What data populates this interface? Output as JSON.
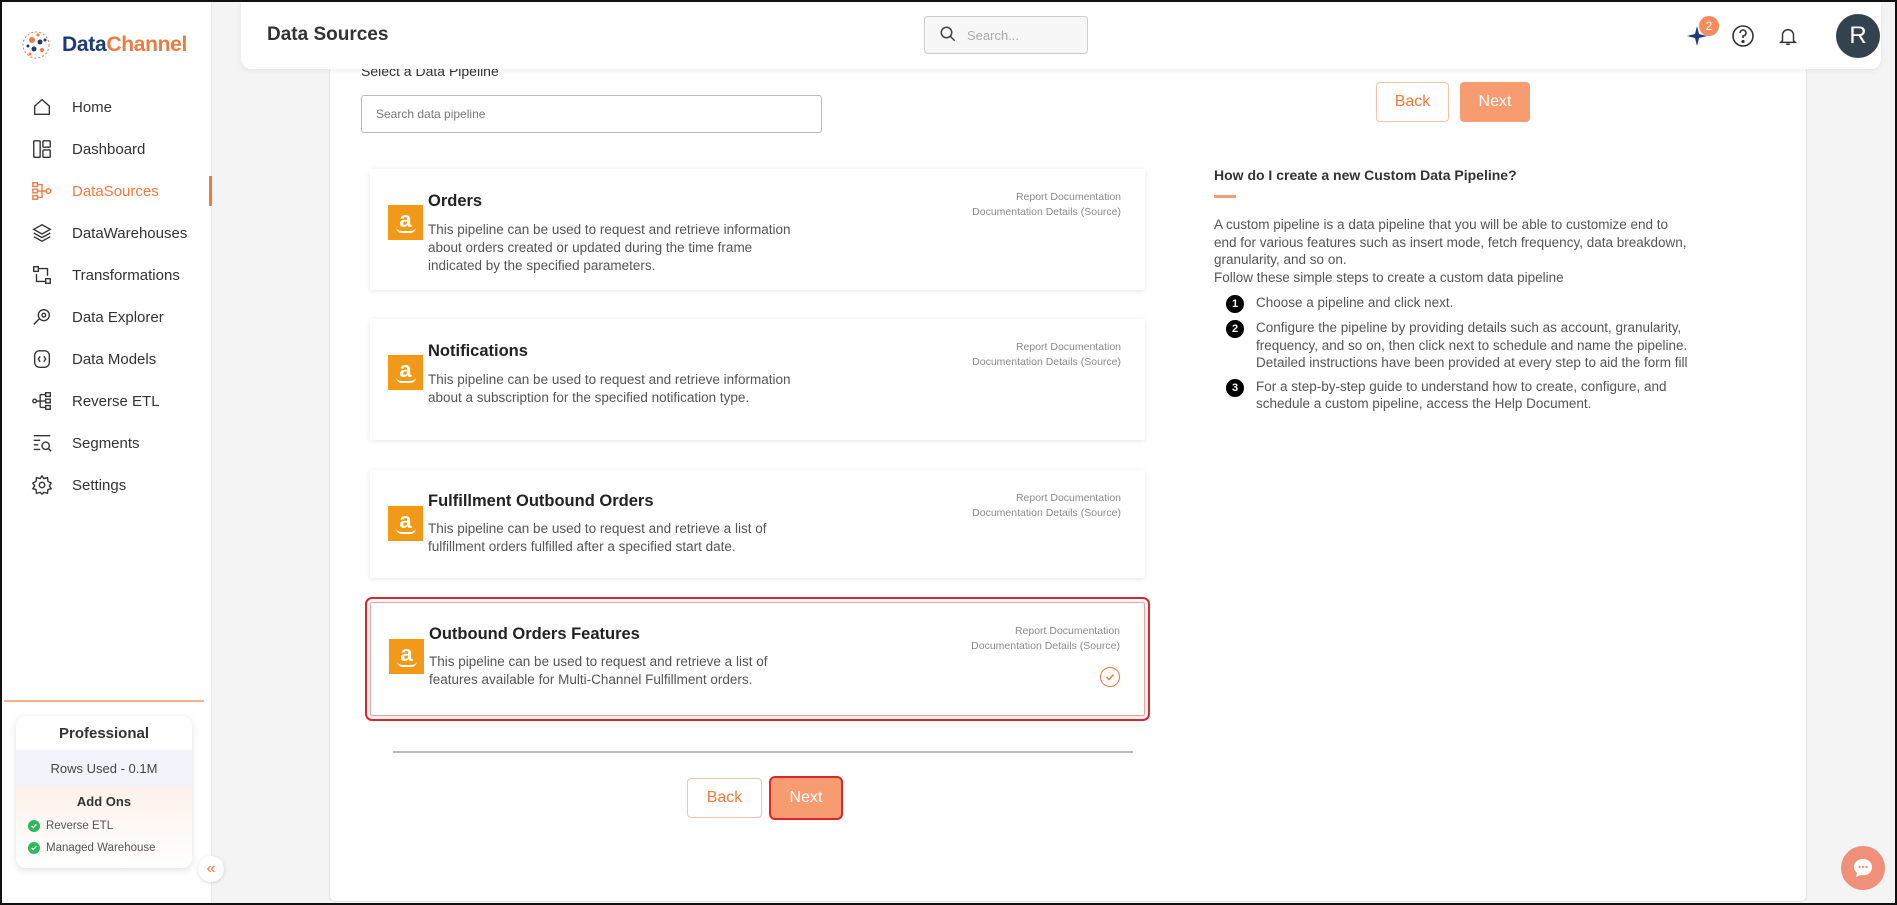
{
  "brand": {
    "name_part1": "Data",
    "name_part2": "Channel"
  },
  "sidebar": {
    "items": [
      {
        "label": "Home",
        "icon": "home-icon"
      },
      {
        "label": "Dashboard",
        "icon": "dashboard-icon"
      },
      {
        "label": "DataSources",
        "icon": "datasources-icon",
        "active": true
      },
      {
        "label": "DataWarehouses",
        "icon": "datawarehouses-icon"
      },
      {
        "label": "Transformations",
        "icon": "transformations-icon"
      },
      {
        "label": "Data Explorer",
        "icon": "data-explorer-icon"
      },
      {
        "label": "Data Models",
        "icon": "data-models-icon"
      },
      {
        "label": "Reverse ETL",
        "icon": "reverse-etl-icon"
      },
      {
        "label": "Segments",
        "icon": "segments-icon"
      },
      {
        "label": "Settings",
        "icon": "settings-icon"
      }
    ],
    "plan": {
      "name": "Professional",
      "rows_used": "Rows Used - 0.1M",
      "addons_title": "Add Ons",
      "addons": [
        "Reverse ETL",
        "Managed Warehouse"
      ]
    }
  },
  "header": {
    "title": "Data Sources",
    "search_placeholder": "Search...",
    "notification_badge": "2",
    "avatar_initial": "R"
  },
  "main": {
    "select_label": "Select a Data Pipeline",
    "search_placeholder": "Search data pipeline",
    "back_label": "Back",
    "next_label": "Next",
    "pipelines": [
      {
        "title": "Orders",
        "desc": "This pipeline can be used to request and retrieve information about orders created or updated during the time frame indicated by the specified parameters.",
        "link1": "Report Documentation",
        "link2": "Documentation Details (Source)"
      },
      {
        "title": "Notifications",
        "desc": "This pipeline can be used to request and retrieve information about a subscription for the specified notification type.",
        "link1": "Report Documentation",
        "link2": "Documentation Details (Source)"
      },
      {
        "title": "Fulfillment Outbound Orders",
        "desc": "This pipeline can be used to request and retrieve a list of fulfillment orders fulfilled after a specified start date.",
        "link1": "Report Documentation",
        "link2": "Documentation Details (Source)"
      },
      {
        "title": "Outbound Orders Features",
        "desc": "This pipeline can be used to request and retrieve a list of features available for Multi-Channel Fulfillment orders.",
        "link1": "Report Documentation",
        "link2": "Documentation Details (Source)",
        "selected": true
      }
    ]
  },
  "help": {
    "title": "How do I create a new Custom Data Pipeline?",
    "intro": "A custom pipeline is a data pipeline that you will be able to customize end to end for various features such as insert mode, fetch frequency, data breakdown, granularity, and so on.",
    "follow": "Follow these simple steps to create a custom data pipeline",
    "steps": [
      {
        "num": "1",
        "text": "Choose a pipeline and click next."
      },
      {
        "num": "2",
        "text": "Configure the pipeline by providing details such as account, granularity, frequency, and so on, then click next to schedule and name the pipeline. Detailed instructions have been provided at every step to aid the form fill"
      },
      {
        "num": "3",
        "text": "For a step-by-step guide to understand how to create, configure, and schedule a custom pipeline, access the Help Document."
      }
    ]
  },
  "colors": {
    "accent": "#f07a3e",
    "button": "#f79b70",
    "highlight": "#d8272d",
    "amazon": "#f29a17"
  }
}
